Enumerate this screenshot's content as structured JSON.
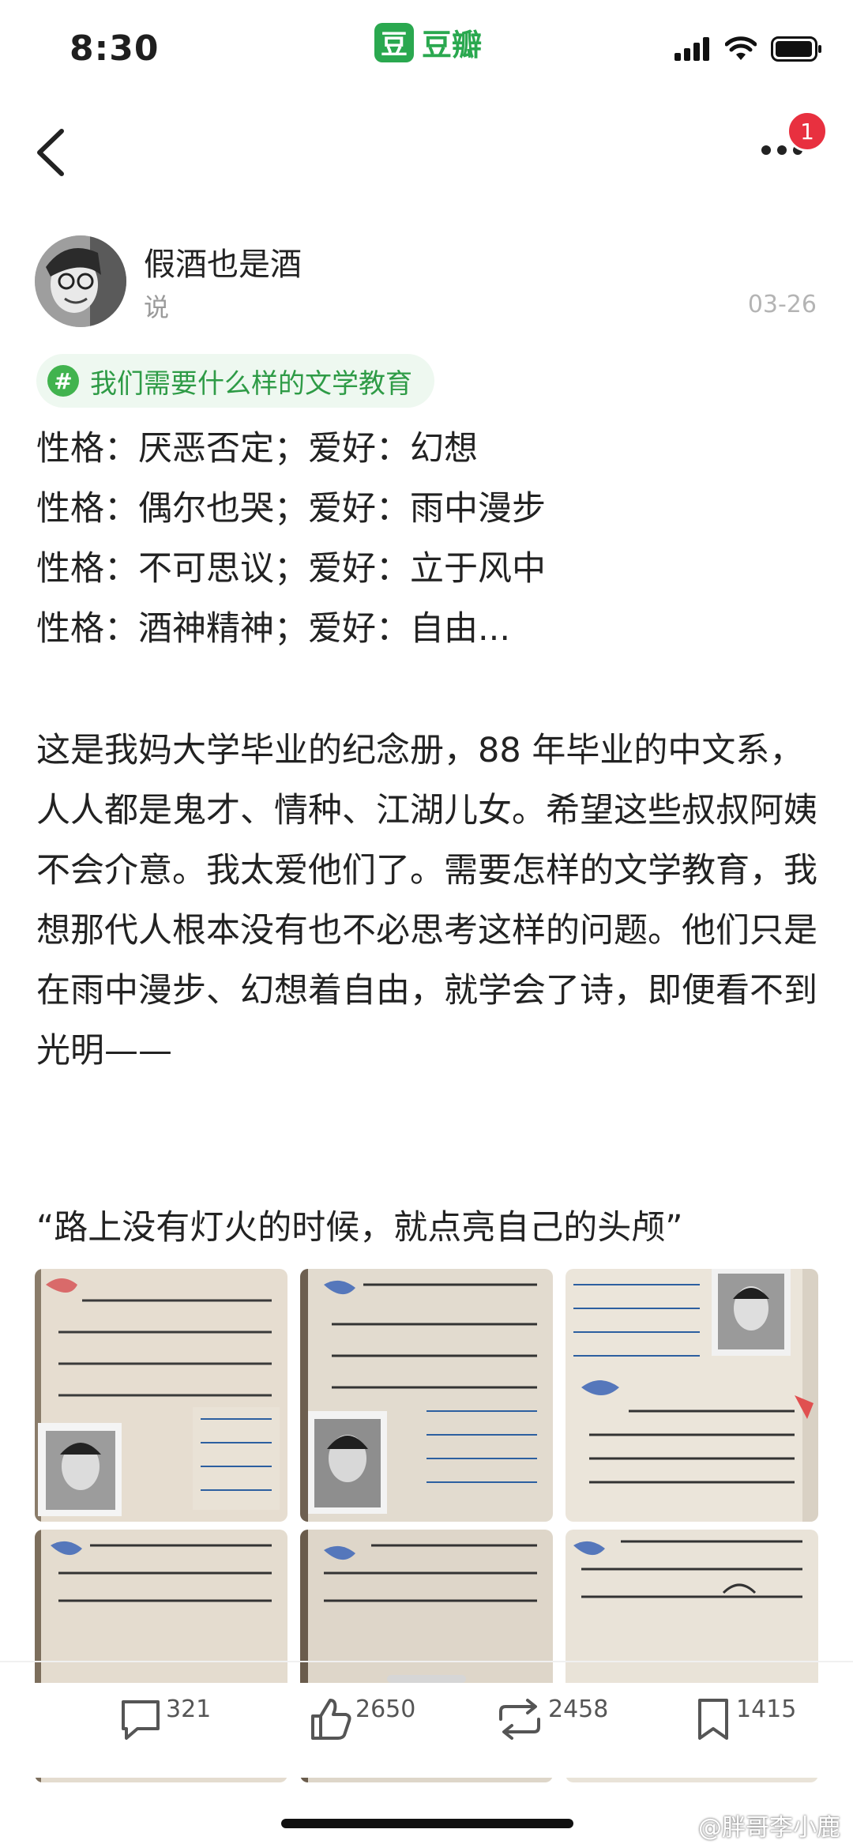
{
  "status_bar": {
    "time": "8:30",
    "app_logo_char": "豆",
    "app_name": "豆瓣"
  },
  "nav": {
    "back_icon": "chevron-left-icon",
    "more_icon": "more-dots-icon",
    "badge_count": "1"
  },
  "author": {
    "name": "假酒也是酒",
    "action": "说",
    "date": "03-26"
  },
  "topic": {
    "icon_char": "#",
    "label": "我们需要什么样的文学教育"
  },
  "post": {
    "lines": [
      "性格：厌恶否定；爱好：幻想",
      "性格：偶尔也哭；爱好：雨中漫步",
      "性格：不可思议；爱好：立于风中",
      "性格：酒神精神；爱好：自由..."
    ],
    "paragraph": "这是我妈大学毕业的纪念册，88 年毕业的中文系，人人都是鬼才、情种、江湖儿女。希望这些叔叔阿姨不会介意。我太爱他们了。需要怎样的文学教育，我想那代人根本没有也不必思考这样的问题。他们只是在雨中漫步、幻想着自由，就学会了诗，即便看不到光明——",
    "quote": "“路上没有灯火的时候，就点亮自己的头颅”"
  },
  "actions": {
    "comments": "321",
    "likes": "2650",
    "reshares": "2458",
    "collects": "1415"
  },
  "watermark": "@胖哥李小鹿",
  "colors": {
    "brand_green": "#2aa84f",
    "badge_red": "#e8303f",
    "topic_bg": "#eef8f0"
  }
}
